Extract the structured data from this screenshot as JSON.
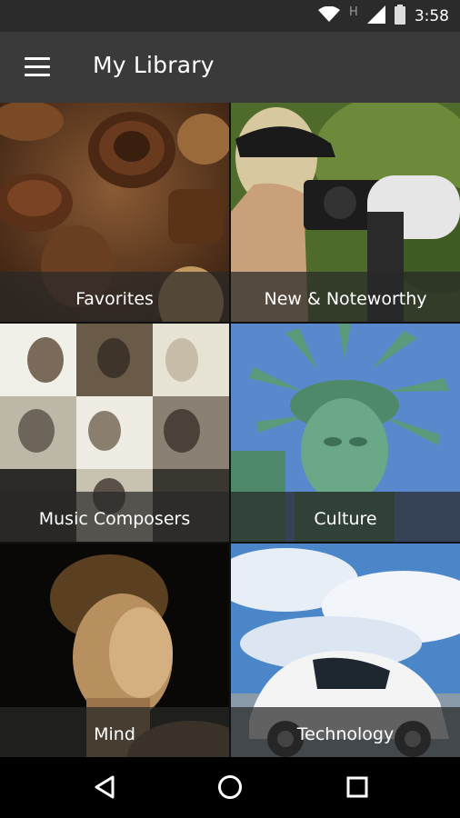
{
  "status_bar": {
    "time": "3:58",
    "network_label": "H",
    "icons": [
      "wifi-icon",
      "network-type-icon",
      "signal-icon",
      "battery-icon"
    ]
  },
  "app_bar": {
    "title": "My Library",
    "menu_icon": "hamburger-menu-icon"
  },
  "tiles": [
    {
      "label": "Favorites"
    },
    {
      "label": "New & Noteworthy"
    },
    {
      "label": "Music Composers"
    },
    {
      "label": "Culture"
    },
    {
      "label": "Mind"
    },
    {
      "label": "Technology"
    }
  ],
  "nav_bar": {
    "icons": [
      "back-icon",
      "home-icon",
      "recents-icon"
    ]
  },
  "colors": {
    "status_bar": "#2b2b2b",
    "app_bar": "#3a3a3a",
    "caption_overlay": "#282828"
  }
}
